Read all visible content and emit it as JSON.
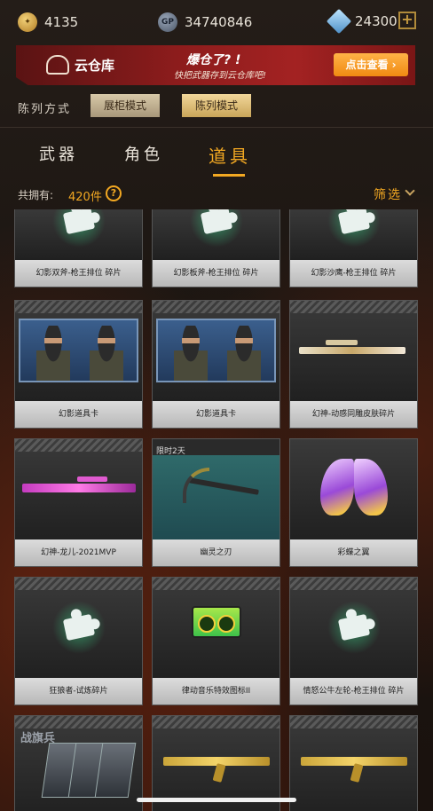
{
  "topbar": {
    "coin_text": "4135",
    "gp_label": "GP",
    "gp_value": "34740846",
    "gem_value": "24300",
    "plus": "+"
  },
  "banner": {
    "cloud_title": "云仓库",
    "slogan_line1": "爆仓了? !",
    "slogan_line2": "快把武器存到云仓库吧!",
    "view_button": "点击查看 ›"
  },
  "sort": {
    "label": "陈列方式",
    "options": [
      "展柜模式",
      "陈列模式"
    ]
  },
  "tabs": [
    "武器",
    "角色",
    "道具"
  ],
  "count": {
    "label": "共拥有:",
    "value": "420件",
    "help": "?"
  },
  "filter": {
    "label": "筛选"
  },
  "items": [
    {
      "name": "幻影双斧-枪王排位 碎片",
      "art": "puzzle"
    },
    {
      "name": "幻影板斧-枪王排位 碎片",
      "art": "puzzle"
    },
    {
      "name": "幻影沙鹰-枪王排位 碎片",
      "art": "puzzle"
    },
    {
      "name": "幻影道具卡",
      "art": "soldiers"
    },
    {
      "name": "幻影道具卡",
      "art": "soldiers"
    },
    {
      "name": "幻神-动感同雕皮肤碎片",
      "art": "sniper"
    },
    {
      "name": "幻神-龙儿-2021MVP",
      "art": "pinkrifle"
    },
    {
      "name": "幽灵之刃",
      "art": "pickaxe",
      "tag": "限时2天"
    },
    {
      "name": "彩蝶之翼",
      "art": "wings"
    },
    {
      "name": "狂狼者-试炼碎片",
      "art": "puzzle"
    },
    {
      "name": "律动音乐特效图标II",
      "art": "radio"
    },
    {
      "name": "情怒公牛左轮-枪王排位 碎片",
      "art": "puzzle"
    },
    {
      "name": "",
      "art": "flagcards",
      "title": "战旗兵"
    },
    {
      "name": "",
      "art": "goldak"
    },
    {
      "name": "",
      "art": "goldak"
    }
  ]
}
